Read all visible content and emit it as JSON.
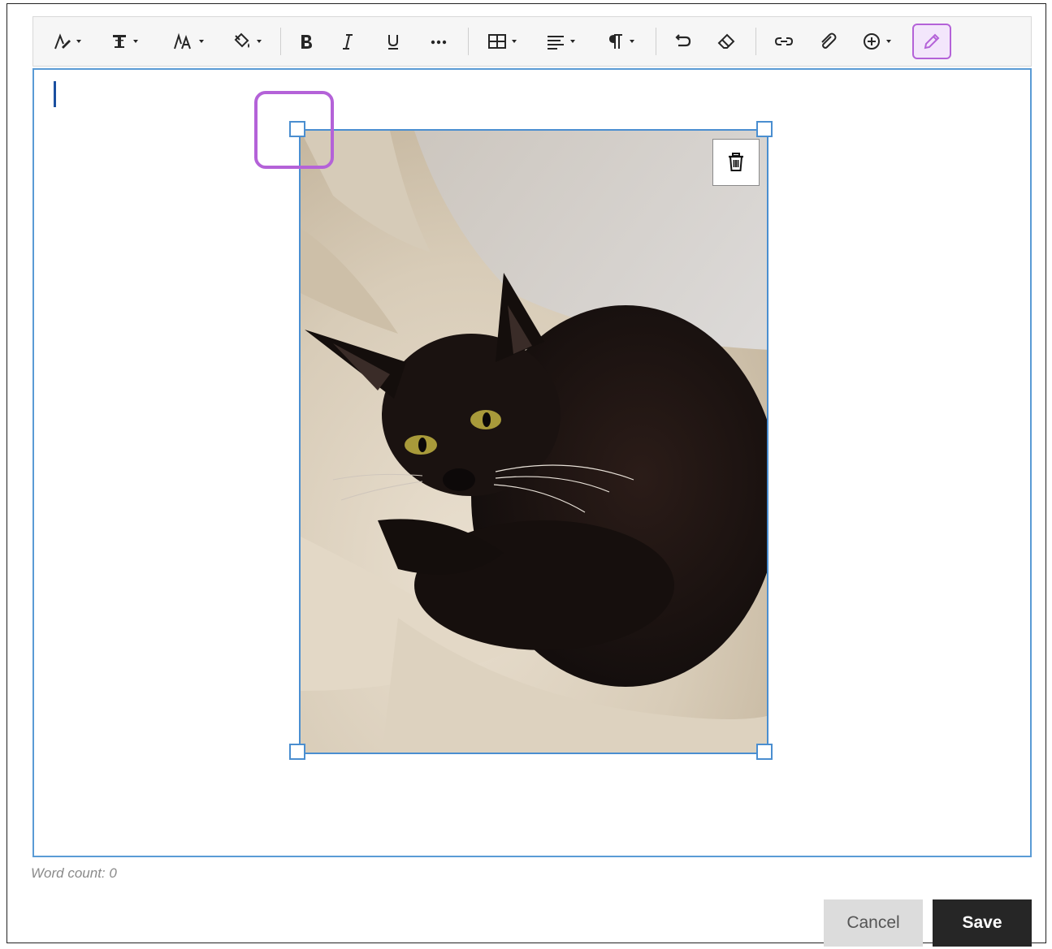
{
  "toolbar": {
    "items": [
      {
        "name": "text-style",
        "icon": "text-style-icon"
      },
      {
        "name": "font-family",
        "icon": "font-family-icon"
      },
      {
        "name": "font-size",
        "icon": "font-size-icon"
      },
      {
        "name": "text-color",
        "icon": "paint-bucket-icon"
      },
      {
        "name": "bold",
        "icon": "bold-icon"
      },
      {
        "name": "italic",
        "icon": "italic-icon"
      },
      {
        "name": "underline",
        "icon": "underline-icon"
      },
      {
        "name": "more",
        "icon": "more-icon"
      },
      {
        "name": "table",
        "icon": "table-icon"
      },
      {
        "name": "align",
        "icon": "align-icon"
      },
      {
        "name": "paragraph",
        "icon": "paragraph-icon"
      },
      {
        "name": "undo",
        "icon": "undo-icon"
      },
      {
        "name": "clear-formatting",
        "icon": "eraser-icon"
      },
      {
        "name": "link",
        "icon": "link-icon"
      },
      {
        "name": "attach",
        "icon": "paperclip-icon"
      },
      {
        "name": "insert",
        "icon": "plus-circle-icon"
      },
      {
        "name": "edit",
        "icon": "pencil-icon"
      }
    ]
  },
  "editor": {
    "image": {
      "subject": "black cat on beige blanket",
      "icon": "trash-icon"
    }
  },
  "footer": {
    "word_count": "Word count: 0",
    "cancel_label": "Cancel",
    "save_label": "Save"
  },
  "colors": {
    "accent": "#b462d8",
    "selection": "#4a8ed0",
    "primary_button": "#262626"
  }
}
